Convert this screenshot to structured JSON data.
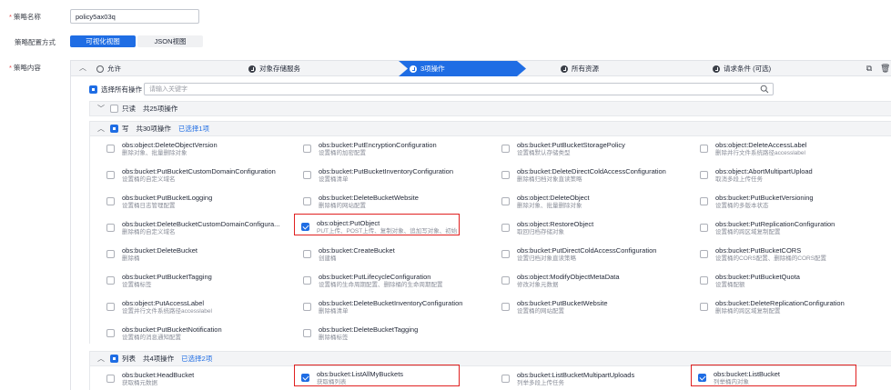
{
  "form": {
    "name_label": "策略名称",
    "name_value": "policy5ax03q",
    "config_label": "策略配置方式",
    "content_label": "策略内容",
    "tabs": [
      "可视化视图",
      "JSON视图"
    ]
  },
  "steps": [
    "允许",
    "对象存储服务",
    "3项操作",
    "所有资源",
    "请求条件 (可选)"
  ],
  "select_all": {
    "label": "选择所有操作",
    "placeholder": "请输入关键字"
  },
  "groups": {
    "readonly": {
      "label": "只读",
      "count": "共25项操作"
    },
    "write": {
      "label": "写",
      "count": "共30项操作",
      "selected": "已选择1项"
    },
    "list": {
      "label": "列表",
      "count": "共4项操作",
      "selected": "已选择2项"
    }
  },
  "write_items": [
    {
      "action": "obs:object:DeleteObjectVersion",
      "desc": "删除对象、批量删除对象",
      "checked": false
    },
    {
      "action": "obs:bucket:PutEncryptionConfiguration",
      "desc": "设置桶的加密配置",
      "checked": false
    },
    {
      "action": "obs:bucket:PutBucketStoragePolicy",
      "desc": "设置桶默认存储类型",
      "checked": false
    },
    {
      "action": "obs:object:DeleteAccessLabel",
      "desc": "删除并行文件系统路径accesslabel",
      "checked": false
    },
    {
      "action": "obs:bucket:PutBucketCustomDomainConfiguration",
      "desc": "设置桶的自定义域名",
      "checked": false
    },
    {
      "action": "obs:bucket:PutBucketInventoryConfiguration",
      "desc": "设置桶清单",
      "checked": false
    },
    {
      "action": "obs:bucket:DeleteDirectColdAccessConfiguration",
      "desc": "删除桶归档对象直读策略",
      "checked": false
    },
    {
      "action": "obs:object:AbortMultipartUpload",
      "desc": "取消多段上传任务",
      "checked": false
    },
    {
      "action": "obs:bucket:PutBucketLogging",
      "desc": "设置桶日志管理配置",
      "checked": false
    },
    {
      "action": "obs:bucket:DeleteBucketWebsite",
      "desc": "删除桶的网站配置",
      "checked": false
    },
    {
      "action": "obs:object:DeleteObject",
      "desc": "删除对象、批量删除对象",
      "checked": false
    },
    {
      "action": "obs:bucket:PutBucketVersioning",
      "desc": "设置桶的多版本状态",
      "checked": false
    },
    {
      "action": "obs:bucket:DeleteBucketCustomDomainConfigura...",
      "desc": "删除桶的自定义域名",
      "checked": false
    },
    {
      "action": "obs:object:PutObject",
      "desc": "PUT上传、POST上传、复制对象、追加写对象、初始",
      "checked": true
    },
    {
      "action": "obs:object:RestoreObject",
      "desc": "取回归档存储对象",
      "checked": false
    },
    {
      "action": "obs:bucket:PutReplicationConfiguration",
      "desc": "设置桶的跨区域复制配置",
      "checked": false
    },
    {
      "action": "obs:bucket:DeleteBucket",
      "desc": "删除桶",
      "checked": false
    },
    {
      "action": "obs:bucket:CreateBucket",
      "desc": "创建桶",
      "checked": false
    },
    {
      "action": "obs:bucket:PutDirectColdAccessConfiguration",
      "desc": "设置归档对象直读策略",
      "checked": false
    },
    {
      "action": "obs:bucket:PutBucketCORS",
      "desc": "设置桶的CORS配置、删除桶的CORS配置",
      "checked": false
    },
    {
      "action": "obs:bucket:PutBucketTagging",
      "desc": "设置桶标签",
      "checked": false
    },
    {
      "action": "obs:bucket:PutLifecycleConfiguration",
      "desc": "设置桶的生命周期配置、删除桶的生命周期配置",
      "checked": false
    },
    {
      "action": "obs:object:ModifyObjectMetaData",
      "desc": "修改对象元数据",
      "checked": false
    },
    {
      "action": "obs:bucket:PutBucketQuota",
      "desc": "设置桶配额",
      "checked": false
    },
    {
      "action": "obs:object:PutAccessLabel",
      "desc": "设置并行文件系统路径accesslabel",
      "checked": false
    },
    {
      "action": "obs:bucket:DeleteBucketInventoryConfiguration",
      "desc": "删除桶清单",
      "checked": false
    },
    {
      "action": "obs:bucket:PutBucketWebsite",
      "desc": "设置桶的网站配置",
      "checked": false
    },
    {
      "action": "obs:bucket:DeleteReplicationConfiguration",
      "desc": "删除桶的跨区域复制配置",
      "checked": false
    },
    {
      "action": "obs:bucket:PutBucketNotification",
      "desc": "设置桶的消息通知配置",
      "checked": false
    },
    {
      "action": "obs:bucket:DeleteBucketTagging",
      "desc": "删除桶标签",
      "checked": false
    }
  ],
  "list_items": [
    {
      "action": "obs:bucket:HeadBucket",
      "desc": "获取桶元数据",
      "checked": false
    },
    {
      "action": "obs:bucket:ListAllMyBuckets",
      "desc": "获取桶列表",
      "checked": true
    },
    {
      "action": "obs:bucket:ListBucketMultipartUploads",
      "desc": "列举多段上传任务",
      "checked": false
    },
    {
      "action": "obs:bucket:ListBucket",
      "desc": "列举桶内对象",
      "checked": true
    }
  ],
  "colors": {
    "primary": "#1f6de4",
    "highlight": "#e02020",
    "required": "#e54545"
  }
}
